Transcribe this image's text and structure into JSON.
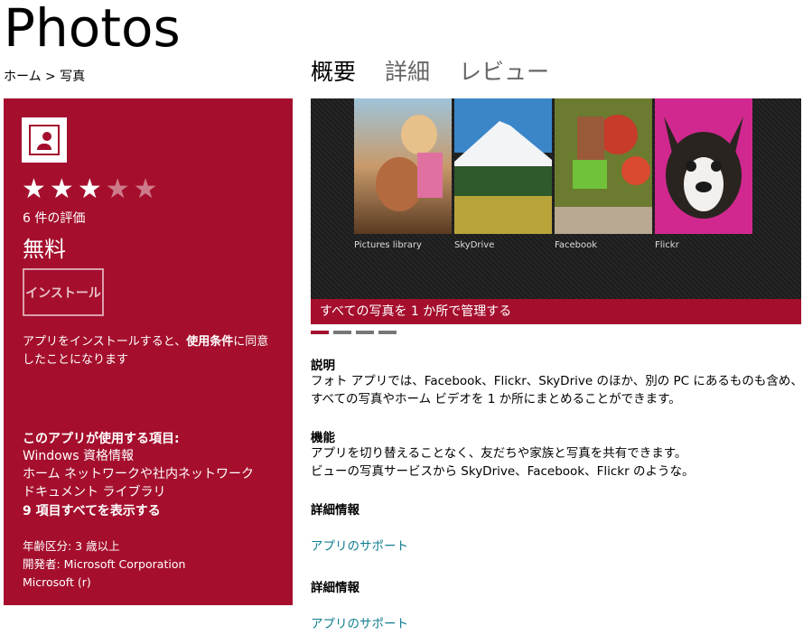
{
  "app": {
    "title": "Photos"
  },
  "breadcrumb": "ホーム > 写真",
  "tabs": [
    {
      "label": "概要"
    },
    {
      "label": "詳細"
    },
    {
      "label": "レビュー"
    }
  ],
  "listing": {
    "rating": {
      "value": 3,
      "max": 5,
      "count_label": "6 件の評価"
    },
    "price": "無料",
    "install_label": "インストール",
    "terms_before": "アプリをインストールすると、",
    "terms_link": "使用条件",
    "terms_after": "に同意したことになります",
    "permissions_heading": "このアプリが使用する項目:",
    "permissions": [
      "Windows 資格情報",
      "ホーム ネットワークや社内ネットワーク",
      "ドキュメント ライブラリ"
    ],
    "show_all": "9 項目すべてを表示する",
    "age_rating": "年齢区分: 3 歳以上",
    "developer": "開発者: Microsoft Corporation",
    "publisher": "Microsoft (r)"
  },
  "hero": {
    "tiles": [
      {
        "label": "Pictures library"
      },
      {
        "label": "SkyDrive"
      },
      {
        "label": "Facebook"
      },
      {
        "label": "Flickr"
      }
    ],
    "caption": "すべての写真を 1 か所で管理する",
    "page_count": 4,
    "active_page": 1
  },
  "sections": {
    "description_title": "説明",
    "description_text": "フォト アプリでは、Facebook、Flickr、SkyDrive のほか、別の PC にあるものも含め、すべての写真やホーム ビデオを 1 か所にまとめることができます。",
    "features_title": "機能",
    "features_line1": "アプリを切り替えることなく、友だちや家族と写真を共有できます。",
    "features_line2": "ビューの写真サービスから SkyDrive、Facebook、Flickr のような。",
    "more_info_title_1": "詳細情報",
    "support_link_1": "アプリのサポート",
    "more_info_title_2": "詳細情報",
    "support_link_2": "アプリのサポート"
  },
  "colors": {
    "accent": "#a50f2d",
    "link": "#0e7d8e"
  }
}
